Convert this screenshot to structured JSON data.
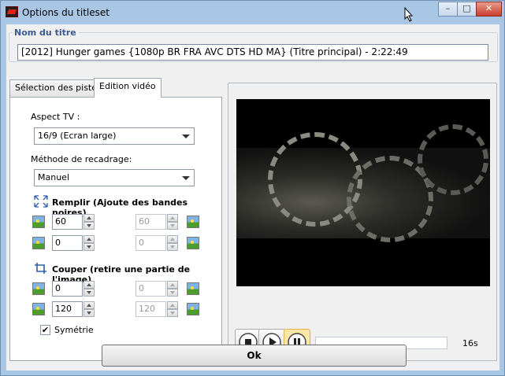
{
  "window": {
    "title": "Options du titleset",
    "min": "–",
    "max": "□",
    "close": "✕"
  },
  "name_group": {
    "title": "Nom du titre",
    "value": "[2012] Hunger games {1080p BR FRA AVC DTS HD MA} (Titre principal) - 2:22:49"
  },
  "tabs": [
    {
      "label": "Sélection des pistes"
    },
    {
      "label": "Edition vidéo"
    }
  ],
  "aspect": {
    "label": "Aspect TV :",
    "value": "16/9 (Ecran large)"
  },
  "crop_method": {
    "label": "Méthode de recadrage:",
    "value": "Manuel"
  },
  "fill": {
    "title": "Remplir (Ajoute des bandes noires)",
    "top_left": "60",
    "top_right": "60",
    "bottom_left": "0",
    "bottom_right": "0"
  },
  "cut": {
    "title": "Couper (retire une partie de l'image)",
    "top_left": "0",
    "top_right": "0",
    "bottom_left": "120",
    "bottom_right": "120"
  },
  "symmetry": {
    "label": "Symétrie",
    "check": "✔",
    "checked": true
  },
  "player": {
    "time": "16s",
    "progress": 0.0
  },
  "ok_label": "Ok"
}
